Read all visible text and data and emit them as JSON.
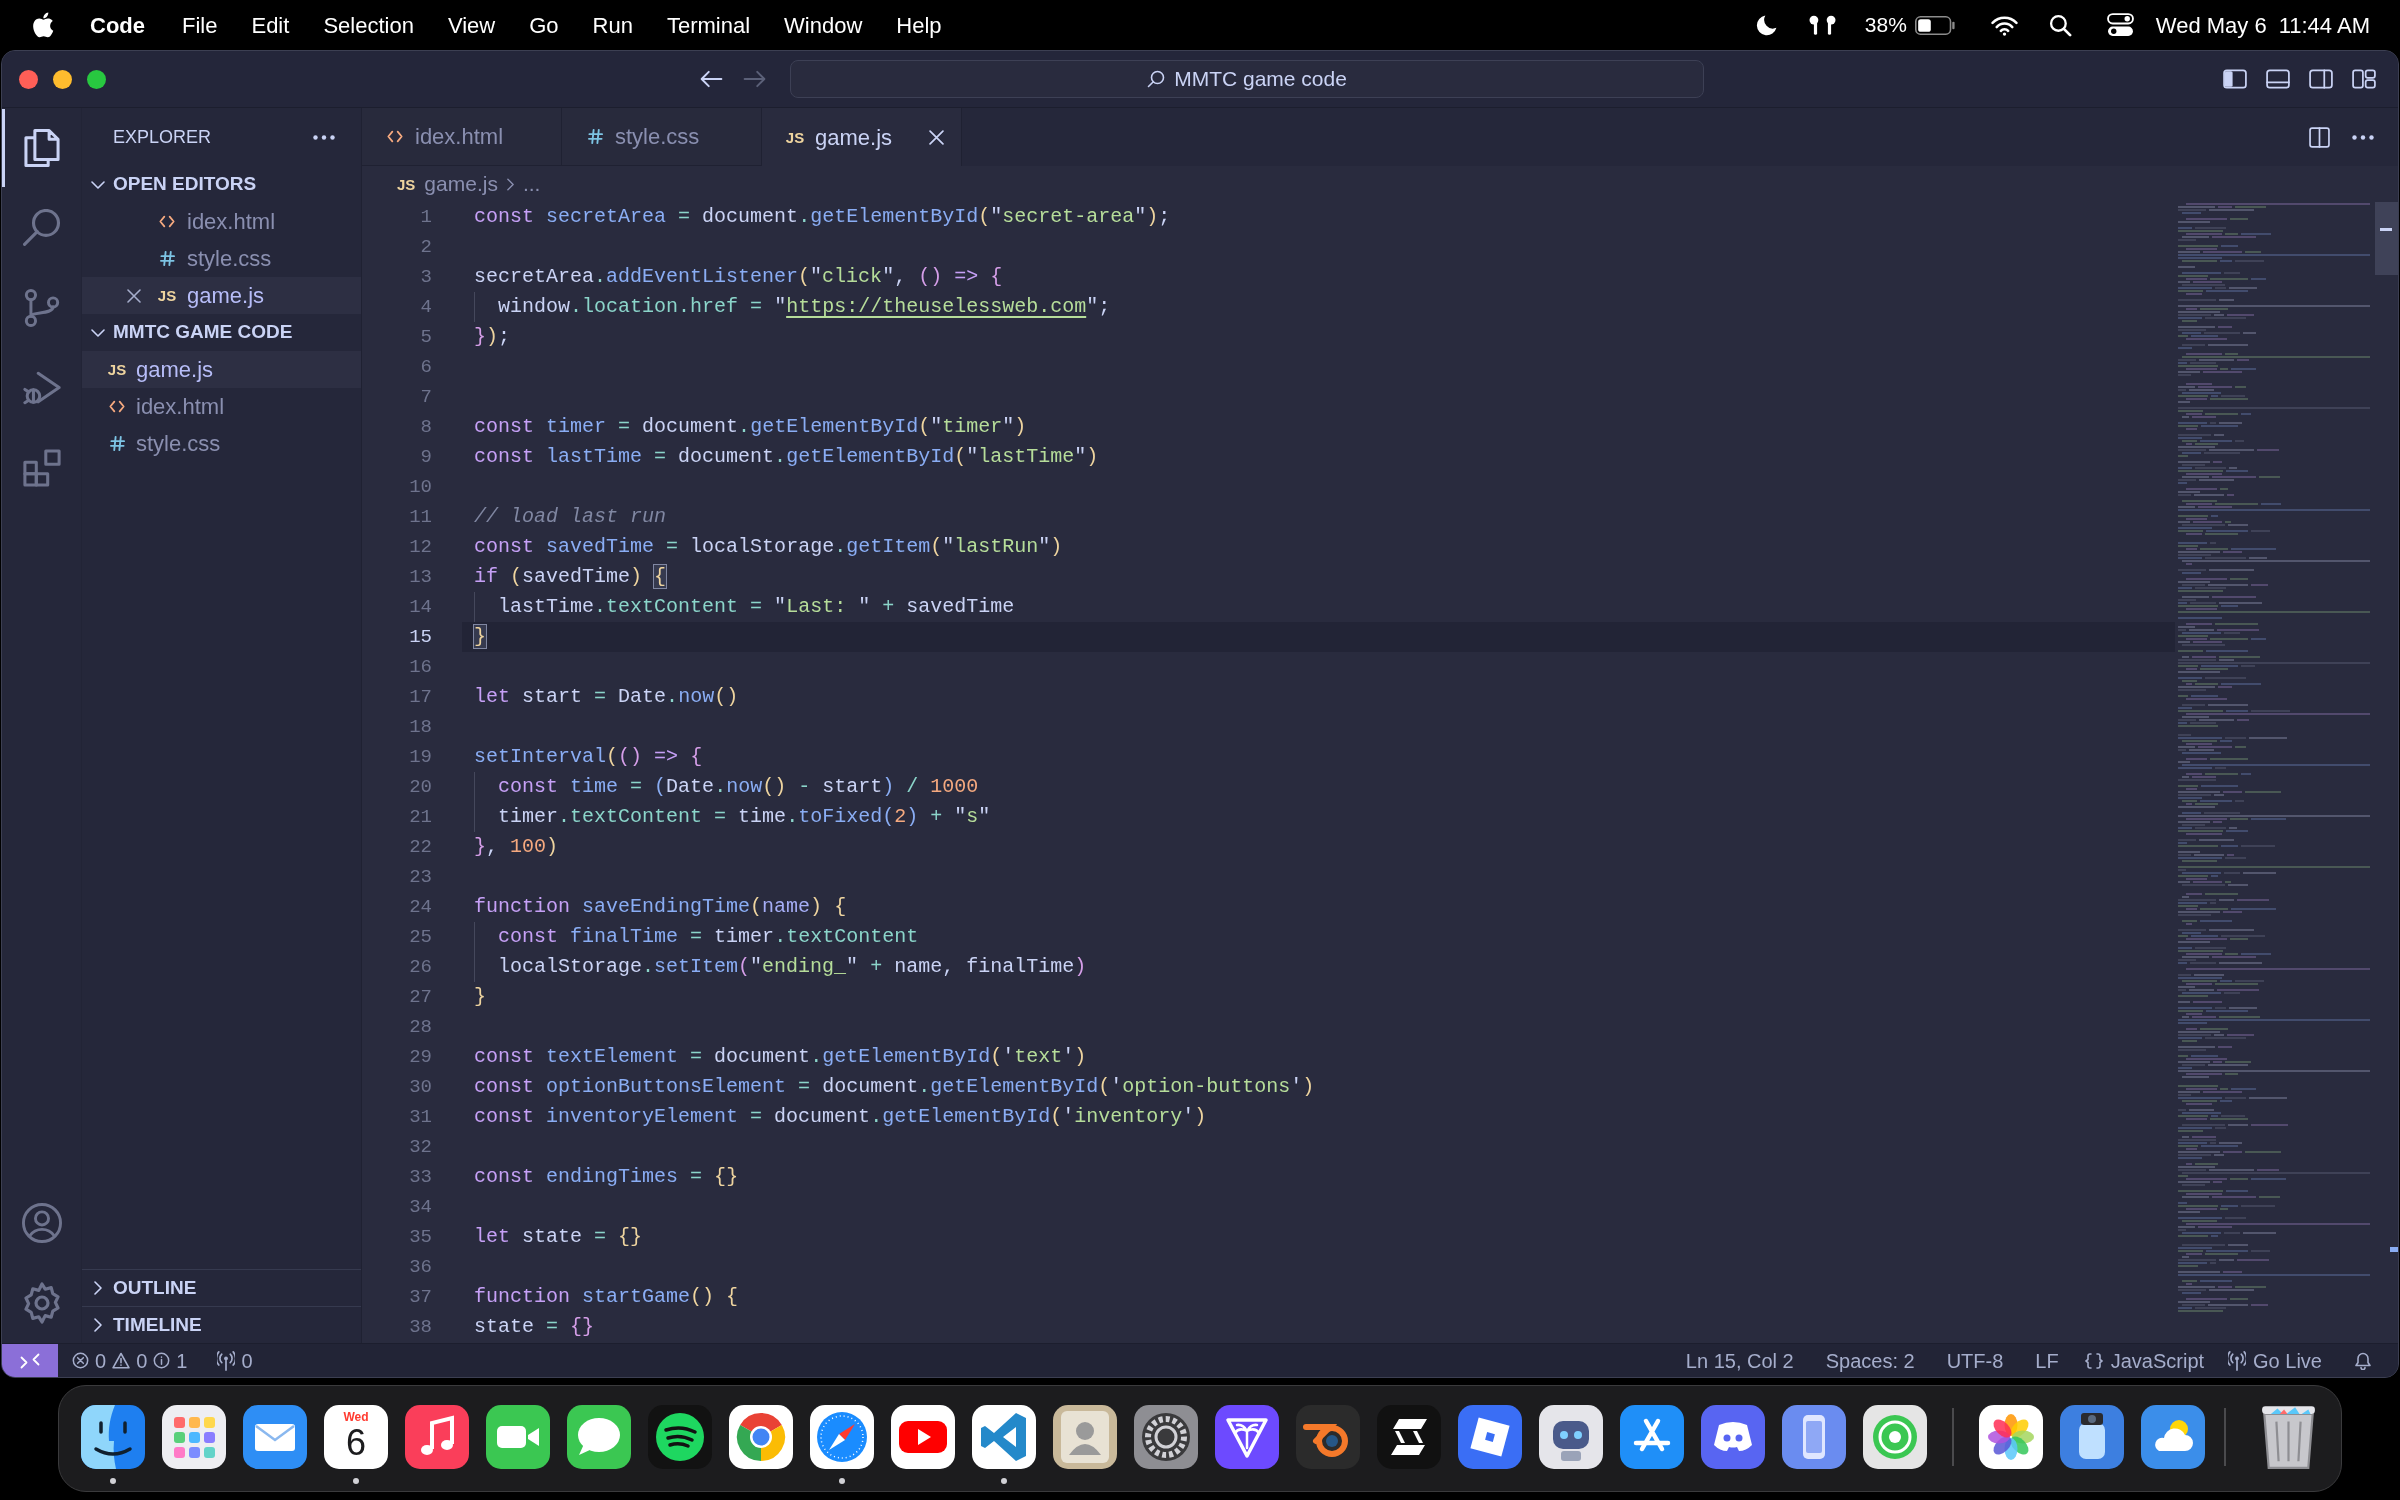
{
  "menu_bar": {
    "app_name": "Code",
    "menus": [
      "File",
      "Edit",
      "Selection",
      "View",
      "Go",
      "Run",
      "Terminal",
      "Window",
      "Help"
    ],
    "battery": "38%",
    "date": "Wed May 6",
    "time": "11:44 AM"
  },
  "window": {
    "title": "MMTC game code"
  },
  "activity_bar": {
    "items": [
      {
        "selected": true
      },
      {
        "selected": false
      },
      {
        "selected": false
      },
      {
        "selected": false
      },
      {
        "selected": false
      }
    ]
  },
  "sidebar": {
    "title": "EXPLORER",
    "sections": [
      {
        "title": "OPEN EDITORS",
        "kind": "open_editors",
        "expanded": true,
        "items": [
          {
            "kind": "html",
            "name": "idex.html",
            "selected": false
          },
          {
            "kind": "css",
            "name": "style.css",
            "selected": false
          },
          {
            "kind": "js",
            "badge": "JS",
            "name": "game.js",
            "selected": true
          }
        ]
      },
      {
        "title": "MMTC GAME CODE",
        "kind": "folder",
        "expanded": true,
        "items": [
          {
            "kind": "js",
            "badge": "JS",
            "name": "game.js",
            "selected": true
          },
          {
            "kind": "html",
            "name": "idex.html",
            "selected": false
          },
          {
            "kind": "css",
            "name": "style.css",
            "selected": false
          }
        ]
      },
      {
        "title": "OUTLINE",
        "kind": "panel",
        "expanded": false
      },
      {
        "title": "TIMELINE",
        "kind": "panel",
        "expanded": false
      }
    ]
  },
  "tabs": [
    {
      "kind": "html",
      "label": "idex.html",
      "selected": false
    },
    {
      "kind": "css",
      "label": "style.css",
      "selected": false
    },
    {
      "kind": "js",
      "badge": "JS",
      "label": "game.js",
      "selected": true
    }
  ],
  "breadcrumb": {
    "kind": "js",
    "badge": "JS",
    "items": [
      "game.js",
      "..."
    ]
  },
  "editor": {
    "lines": [
      {
        "number": "1",
        "text": "const secretArea = document.getElementById(\"secret-area\");",
        "current": false
      },
      {
        "number": "2",
        "current": false
      },
      {
        "number": "3",
        "text": "secretArea.addEventListener(\"click\", () => {",
        "current": false
      },
      {
        "number": "4",
        "text": "  window.location.href = \"https://theuselessweb.com\";",
        "current": false
      },
      {
        "number": "5",
        "text": "});",
        "current": false
      },
      {
        "number": "6",
        "current": false
      },
      {
        "number": "7",
        "current": false
      },
      {
        "number": "8",
        "text": "const timer = document.getElementById(\"timer\")",
        "current": false
      },
      {
        "number": "9",
        "text": "const lastTime = document.getElementById(\"lastTime\")",
        "current": false
      },
      {
        "number": "10",
        "current": false
      },
      {
        "number": "11",
        "text": "// load last run",
        "current": false
      },
      {
        "number": "12",
        "text": "const savedTime = localStorage.getItem(\"lastRun\")",
        "current": false
      },
      {
        "number": "13",
        "text": "if (savedTime) {",
        "current": false
      },
      {
        "number": "14",
        "text": "  lastTime.textContent = \"Last: \" + savedTime",
        "current": false
      },
      {
        "number": "15",
        "text": "}",
        "current": true
      },
      {
        "number": "16",
        "current": false
      },
      {
        "number": "17",
        "text": "let start = Date.now()",
        "current": false
      },
      {
        "number": "18",
        "current": false
      },
      {
        "number": "19",
        "text": "setInterval(() => {",
        "current": false
      },
      {
        "number": "20",
        "text": "  const time = (Date.now() - start) / 1000",
        "current": false
      },
      {
        "number": "21",
        "text": "  timer.textContent = time.toFixed(2) + \"s\"",
        "current": false
      },
      {
        "number": "22",
        "text": "}, 100)",
        "current": false
      },
      {
        "number": "23",
        "current": false
      },
      {
        "number": "24",
        "text": "function saveEndingTime(name) {",
        "current": false
      },
      {
        "number": "25",
        "text": "  const finalTime = timer.textContent",
        "current": false
      },
      {
        "number": "26",
        "text": "  localStorage.setItem(\"ending_\" + name, finalTime)",
        "current": false
      },
      {
        "number": "27",
        "text": "}",
        "current": false
      },
      {
        "number": "28",
        "current": false
      },
      {
        "number": "29",
        "text": "const textElement = document.getElementById('text')",
        "current": false
      },
      {
        "number": "30",
        "text": "const optionButtonsElement = document.getElementById('option-buttons')",
        "current": false
      },
      {
        "number": "31",
        "text": "const inventoryElement = document.getElementById('inventory')",
        "current": false
      },
      {
        "number": "32",
        "current": false
      },
      {
        "number": "33",
        "text": "const endingTimes = {}",
        "current": false
      },
      {
        "number": "34",
        "current": false
      },
      {
        "number": "35",
        "text": "let state = {}",
        "current": false
      },
      {
        "number": "36",
        "current": false
      },
      {
        "number": "37",
        "text": "function startGame() {",
        "current": false
      },
      {
        "number": "38",
        "text": "state = {}",
        "current": false
      }
    ]
  },
  "status_bar": {
    "problems": {
      "errors": "0",
      "warnings": "0",
      "infos": "1"
    },
    "ports": "0",
    "position": "Ln 15, Col 2",
    "indentation": "Spaces: 2",
    "encoding": "UTF-8",
    "eol": "LF",
    "language": "JavaScript",
    "live_server": "Go Live"
  },
  "dock": {
    "groups": [
      [
        {
          "kind": "app",
          "running": true
        },
        {
          "kind": "app",
          "running": false
        },
        {
          "kind": "app",
          "running": false
        },
        {
          "kind": "calendar",
          "day": "Wed",
          "date": "6",
          "running": true
        },
        {
          "kind": "app",
          "running": false
        },
        {
          "kind": "app",
          "running": false
        },
        {
          "kind": "app",
          "running": false
        },
        {
          "kind": "app",
          "running": false
        },
        {
          "kind": "app",
          "running": false
        },
        {
          "kind": "app",
          "running": true
        },
        {
          "kind": "app",
          "running": false
        },
        {
          "kind": "app",
          "running": true
        },
        {
          "kind": "app",
          "running": false
        },
        {
          "kind": "app",
          "running": false
        },
        {
          "kind": "app",
          "running": false
        },
        {
          "kind": "app",
          "running": false
        },
        {
          "kind": "app",
          "running": false
        },
        {
          "kind": "app",
          "running": false
        },
        {
          "kind": "app",
          "running": false
        },
        {
          "kind": "app",
          "running": false
        },
        {
          "kind": "app",
          "running": false
        },
        {
          "kind": "app",
          "running": false
        },
        {
          "kind": "app",
          "running": false
        }
      ],
      [
        {
          "kind": "app",
          "running": false
        },
        {
          "kind": "app",
          "running": false
        },
        {
          "kind": "app",
          "running": false
        }
      ],
      [
        {
          "kind": "trash",
          "running": false
        }
      ]
    ]
  }
}
